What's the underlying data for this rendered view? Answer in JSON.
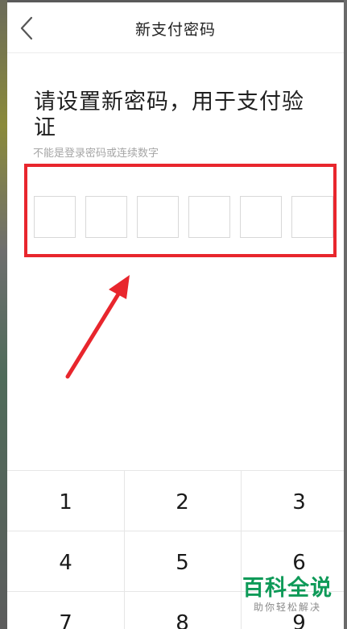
{
  "header": {
    "title": "新支付密码",
    "back_icon": "chevron-left-icon"
  },
  "main": {
    "heading": "请设置新密码，用于支付验证",
    "hint": "不能是登录密码或连续数字",
    "pin_length": 6
  },
  "colors": {
    "highlight": "#e8262d",
    "watermark": "#0e9a58"
  },
  "keypad": {
    "keys": [
      "1",
      "2",
      "3",
      "4",
      "5",
      "6",
      "7",
      "8",
      "9"
    ]
  },
  "watermark": {
    "main": "百科全说",
    "sub": "助你轻松解决"
  }
}
